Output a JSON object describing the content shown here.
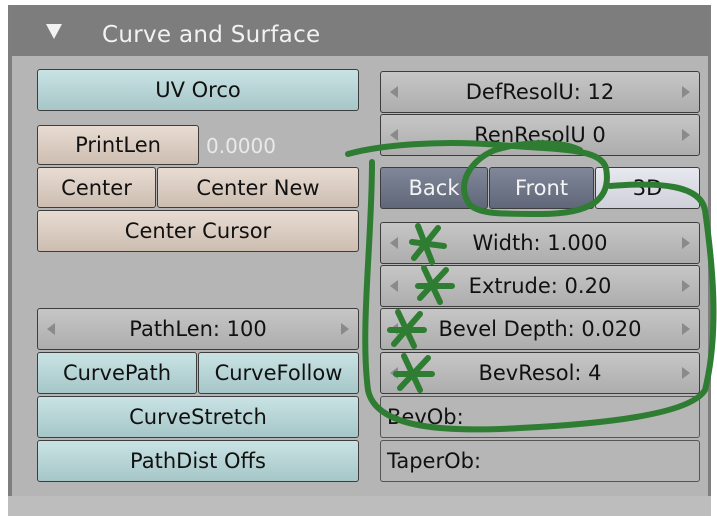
{
  "panel": {
    "title": "Curve and Surface",
    "collapse_icon": "triangle-down-icon"
  },
  "left": {
    "uv_orco": "UV Orco",
    "printlen": "PrintLen",
    "printlen_value": "0.0000",
    "center": "Center",
    "center_new": "Center New",
    "center_cursor": "Center Cursor",
    "pathlen": "PathLen: 100",
    "curvepath": "CurvePath",
    "curvefollow": "CurveFollow",
    "curvestretch": "CurveStretch",
    "pathdist_offs": "PathDist Offs"
  },
  "right": {
    "defresolu": "DefResolU: 12",
    "renresolu": "RenResolU 0",
    "back": "Back",
    "front": "Front",
    "three_d": "3D",
    "width": "Width: 1.000",
    "extrude": "Extrude: 0.20",
    "bevel_depth": "Bevel Depth: 0.020",
    "bevresol": "BevResol: 4",
    "bevob": "BevOb:",
    "taperob": "TaperOb:"
  },
  "colors": {
    "annotation_green": "#2f7d32",
    "teal_button": "#b8d6d7",
    "tan_button": "#dbcdc2"
  }
}
